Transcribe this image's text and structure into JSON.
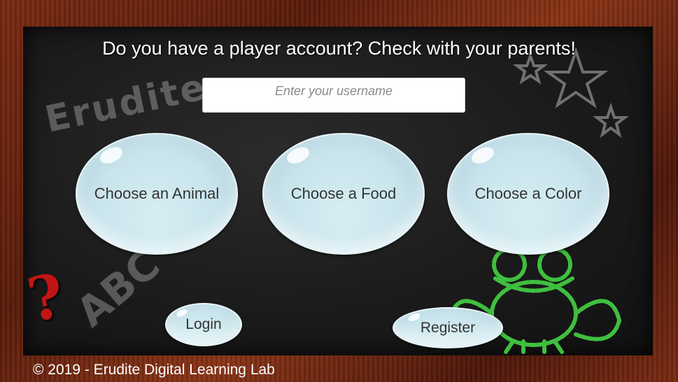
{
  "title": "Do you have a player account? Check with your parents!",
  "username": {
    "placeholder": "Enter your username"
  },
  "choices": [
    {
      "label": "Choose an Animal"
    },
    {
      "label": "Choose a Food"
    },
    {
      "label": "Choose a Color"
    }
  ],
  "buttons": {
    "login": "Login",
    "register": "Register"
  },
  "decor": {
    "chalk_word": "Erudite",
    "chalk_letters": "ABC",
    "help_symbol": "?"
  },
  "footer": "© 2019 - Erudite Digital Learning Lab",
  "colors": {
    "frame": "#7a2a12",
    "board": "#1b1b1b",
    "bubble": "#d6eef3",
    "frog": "#3fbf3f",
    "question": "#c01515"
  }
}
